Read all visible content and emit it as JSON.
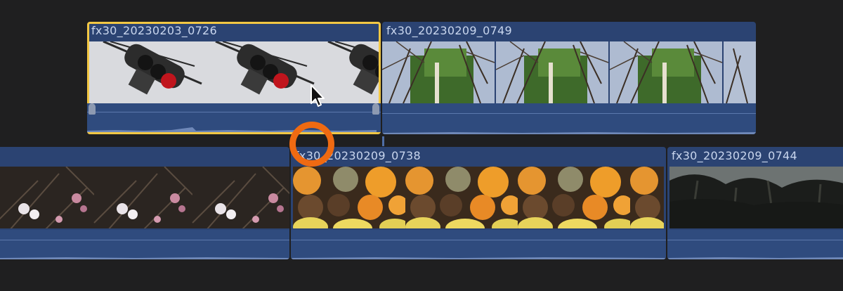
{
  "colors": {
    "background": "#1f1f20",
    "clip": "#2b4372",
    "selection": "#f2c744",
    "click_indicator": "#ef6a12"
  },
  "timeline": {
    "connected_clips": [
      {
        "title": "fx30_20230203_0726",
        "selected": true,
        "thumbnail": "traffic-light"
      },
      {
        "title": "fx30_20230209_0749",
        "selected": false,
        "thumbnail": "bamboo-trees"
      }
    ],
    "primary_clips": [
      {
        "title": "",
        "thumbnail": "plum-blossoms"
      },
      {
        "title": "fx30_20230209_0738",
        "thumbnail": "citrus-pinecones"
      },
      {
        "title": "fx30_20230209_0744",
        "thumbnail": "dark-forest"
      }
    ]
  },
  "cursor": {
    "icon": "arrow-pointer-icon"
  },
  "indicator": {
    "icon": "click-indicator-ring"
  }
}
